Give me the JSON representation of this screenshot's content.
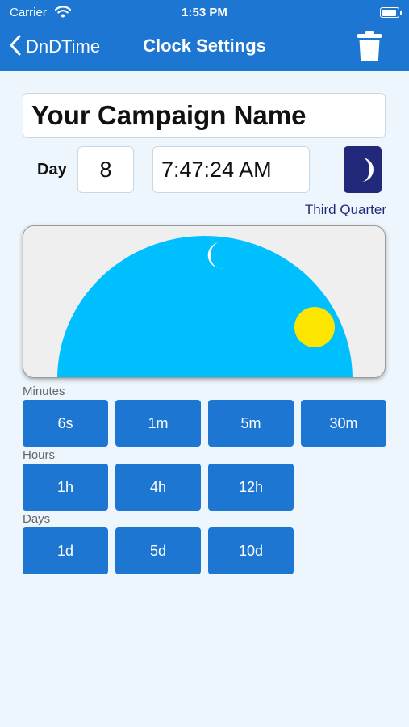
{
  "status_bar": {
    "carrier": "Carrier",
    "time": "1:53 PM"
  },
  "nav": {
    "back_label": "DnDTime",
    "title": "Clock Settings"
  },
  "campaign": {
    "name": "Your Campaign Name"
  },
  "day": {
    "label": "Day",
    "value": "8"
  },
  "time": {
    "value": "7:47:24 AM"
  },
  "moon": {
    "phase": "Third Quarter"
  },
  "sections": {
    "minutes": {
      "label": "Minutes",
      "buttons": [
        "6s",
        "1m",
        "5m",
        "30m"
      ]
    },
    "hours": {
      "label": "Hours",
      "buttons": [
        "1h",
        "4h",
        "12h"
      ]
    },
    "days": {
      "label": "Days",
      "buttons": [
        "1d",
        "5d",
        "10d"
      ]
    }
  },
  "colors": {
    "nav_bar": "#1d76d2",
    "button": "#1d76d2",
    "sky": "#00bfff",
    "sun": "#fce600",
    "moon_button": "#23297a",
    "background": "#eef6fd"
  },
  "icons": [
    "wifi-icon",
    "battery-icon",
    "back-chevron-icon",
    "trash-icon",
    "moon-icon",
    "sun-icon"
  ]
}
